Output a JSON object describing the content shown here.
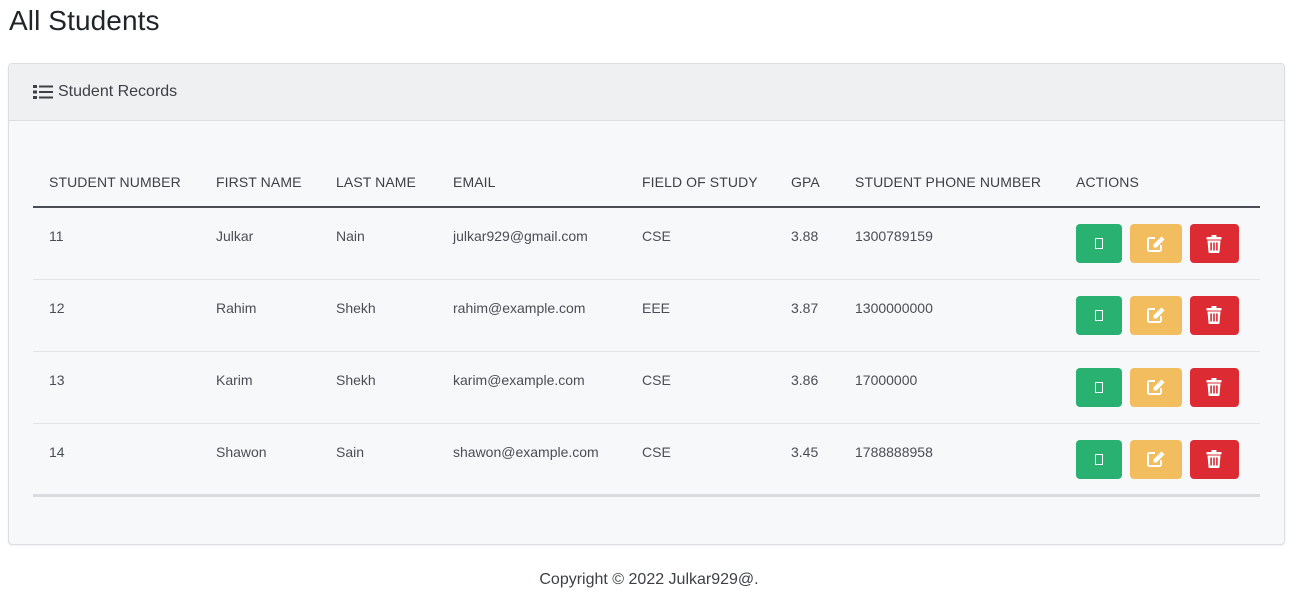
{
  "page": {
    "title": "All Students"
  },
  "card": {
    "title": "Student Records",
    "icon": "list-icon"
  },
  "table": {
    "columns": [
      "STUDENT NUMBER",
      "FIRST NAME",
      "LAST NAME",
      "EMAIL",
      "FIELD OF STUDY",
      "GPA",
      "STUDENT PHONE NUMBER",
      "ACTIONS"
    ],
    "rows": [
      {
        "student_number": "11",
        "first_name": "Julkar",
        "last_name": "Nain",
        "email": "julkar929@gmail.com",
        "field_of_study": "CSE",
        "gpa": "3.88",
        "phone": "1300789159"
      },
      {
        "student_number": "12",
        "first_name": "Rahim",
        "last_name": "Shekh",
        "email": "rahim@example.com",
        "field_of_study": "EEE",
        "gpa": "3.87",
        "phone": "1300000000"
      },
      {
        "student_number": "13",
        "first_name": "Karim",
        "last_name": "Shekh",
        "email": "karim@example.com",
        "field_of_study": "CSE",
        "gpa": "3.86",
        "phone": "17000000"
      },
      {
        "student_number": "14",
        "first_name": "Shawon",
        "last_name": "Sain",
        "email": "shawon@example.com",
        "field_of_study": "CSE",
        "gpa": "3.45",
        "phone": "1788888958"
      }
    ],
    "actions": [
      {
        "name": "view",
        "icon": "view-icon",
        "color": "#28b170"
      },
      {
        "name": "edit",
        "icon": "edit-icon",
        "color": "#f2bd5e"
      },
      {
        "name": "delete",
        "icon": "trash-icon",
        "color": "#dd2b33"
      }
    ]
  },
  "footer": {
    "text": "Copyright © 2022 Julkar929@."
  }
}
